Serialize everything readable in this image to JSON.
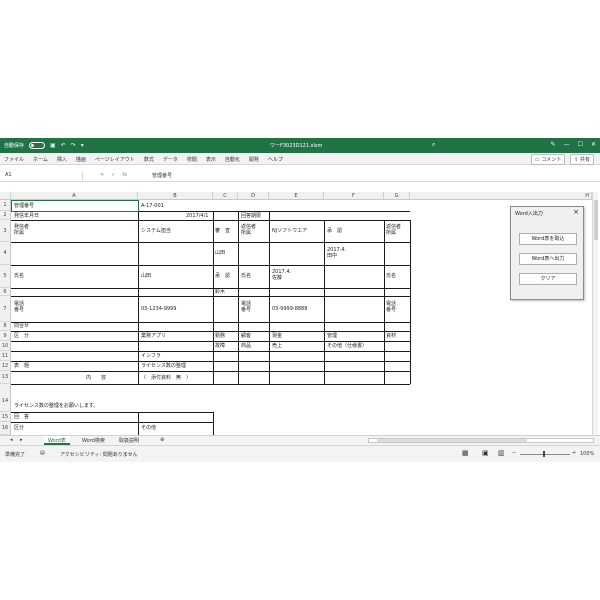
{
  "titlebar": {
    "autosave_label": "自動保存",
    "autosave_state": "オフ",
    "filename": "ワーF3023D121.xlsm",
    "search_icon": "search-icon"
  },
  "ribbon": {
    "tabs": [
      "ファイル",
      "ホーム",
      "挿入",
      "描画",
      "ページレイアウト",
      "数式",
      "データ",
      "校閲",
      "表示",
      "自動化",
      "開発",
      "ヘルプ"
    ],
    "comment_label": "コメント",
    "share_label": "共有"
  },
  "formula_bar": {
    "name_box": "A1",
    "fx": "fx",
    "content": "管理番号"
  },
  "columns": [
    "A",
    "B",
    "C",
    "D",
    "E",
    "F",
    "G",
    "H"
  ],
  "rows": [
    "1",
    "2",
    "3",
    "4",
    "5",
    "6",
    "7",
    "8",
    "9",
    "10",
    "11",
    "12",
    "13",
    "14",
    "15",
    "16"
  ],
  "cells": {
    "r1_a": "管理番号",
    "r1_b": "A-17-001",
    "r2_a": "発信年月日",
    "r2_b": "2017/4/1",
    "r2_d": "回答期限",
    "r3_a": "発信者\n所属",
    "r3_b": "システム担当",
    "r3_c": "審　査",
    "r3_d": "返信者\n所属",
    "r3_e": "Njソフトウエア",
    "r3_f": "承　認",
    "r3_g": "返信者\n所属",
    "r4_b": "山田",
    "r4_f": "2017.4.\n田中",
    "r5_a": "氏名",
    "r5_b": "山田",
    "r5_c": "承　認",
    "r5_d": "氏名",
    "r5_e": "2017.4.\n佐藤",
    "r5_g": "氏名",
    "r6_c": "鈴木",
    "r7_a": "電話\n番号",
    "r7_b": "03-1234-9999",
    "r7_d": "電話\n番号",
    "r7_e": "03-9999-8888",
    "r7_g": "電話\n番号",
    "r8_a": "問合せ",
    "r9_a": "区　分",
    "r9_b": "業務アプリ",
    "r9_c": "勤務",
    "r9_d": "顧客",
    "r9_e": "現金",
    "r9_f": "管理",
    "r9_g": "資材",
    "r10_c": "故障",
    "r10_d": "商品",
    "r10_e": "売上",
    "r10_f": "その他（仕様書）",
    "r11_b": "インフラ",
    "r12_a": "表　題",
    "r12_b": "ライセンス数の整理",
    "r13_a": "内　　容",
    "r13_b": "（　添付資料　無　）",
    "r14_a": "ライセンス数の整理をお願いします。",
    "r15_a": "回　答",
    "r16_a": "区分",
    "r16_b": "その他"
  },
  "dialog": {
    "title": "Word入出力",
    "close": "×",
    "btn_import": "Word表を取込",
    "btn_export": "Word表へ出力",
    "btn_clear": "クリア"
  },
  "sheets": {
    "tabs": [
      "Word表",
      "Word検索",
      "取扱説明"
    ],
    "active": "Word表"
  },
  "status": {
    "ready": "準備完了",
    "accessibility": "アクセシビリティ: 問題ありません",
    "zoom": "100%"
  },
  "colors": {
    "excel_green": "#217346"
  }
}
